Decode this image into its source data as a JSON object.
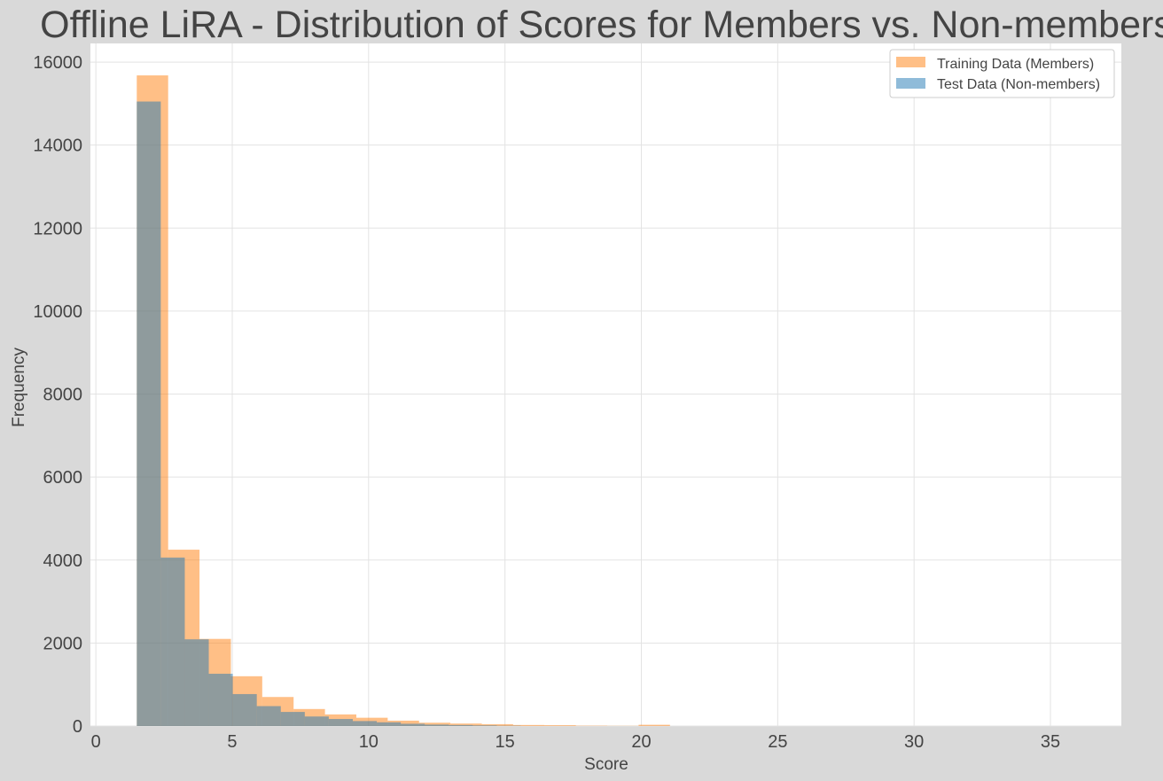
{
  "chart_data": {
    "type": "bar",
    "title": "Offline LiRA - Distribution of Scores for Members vs. Non-members",
    "xlabel": "Score",
    "ylabel": "Frequency",
    "xlim": [
      -0.2,
      37.6
    ],
    "ylim": [
      0,
      16450
    ],
    "xticks": [
      0,
      5,
      10,
      15,
      20,
      25,
      30,
      35
    ],
    "yticks": [
      0,
      2000,
      4000,
      6000,
      8000,
      10000,
      12000,
      14000,
      16000
    ],
    "grid": true,
    "legend_position": "top-right",
    "series": [
      {
        "name": "Training Data (Members)",
        "color": "#ff7f0e",
        "opacity": 0.5,
        "bin_edges": [
          1.5,
          2.65,
          3.8,
          4.95,
          6.1,
          7.25,
          8.4,
          9.55,
          10.7,
          11.85,
          13.0,
          14.15,
          15.3,
          16.45,
          17.6,
          18.75,
          19.9,
          21.05
        ],
        "counts": [
          15680,
          4250,
          2100,
          1200,
          700,
          410,
          280,
          200,
          130,
          80,
          60,
          45,
          25,
          20,
          8,
          4,
          30
        ]
      },
      {
        "name": "Test Data (Non-members)",
        "color": "#1f77b4",
        "opacity": 0.5,
        "bin_edges": [
          1.5,
          2.38,
          3.26,
          4.14,
          5.02,
          5.9,
          6.78,
          7.66,
          8.54,
          9.42,
          10.3,
          11.18,
          12.06,
          12.94,
          13.82,
          14.7,
          15.58
        ],
        "counts": [
          15050,
          4060,
          2090,
          1260,
          770,
          480,
          340,
          230,
          170,
          120,
          90,
          55,
          35,
          25,
          15,
          6
        ]
      }
    ]
  }
}
